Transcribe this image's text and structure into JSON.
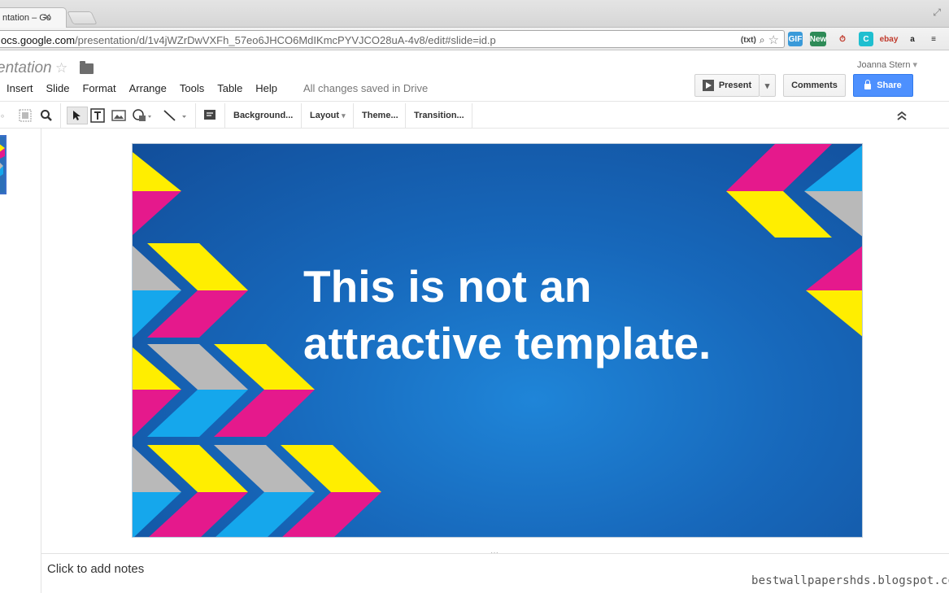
{
  "browser": {
    "tab_title": "ntation – Go",
    "tab_close": "✕",
    "url_host": "ocs.google.com",
    "url_path": "/presentation/d/1v4jWZrDwVXFh_57eo6JHCO6MdIKmcPYVJCO28uA-4v8/edit#slide=id.p",
    "txt_badge": "(txt)",
    "extensions": [
      {
        "name": "gif-extension",
        "label": "GIF",
        "color": "#3a9ad9"
      },
      {
        "name": "new-extension",
        "label": "New",
        "color": "#2e8b57"
      },
      {
        "name": "timer-extension",
        "label": "⏱",
        "color": "#e9e9e9"
      },
      {
        "name": "c-extension",
        "label": "C",
        "color": "#1fbfd0"
      },
      {
        "name": "ebay-extension",
        "label": "ebay",
        "color": "#e9e9e9"
      },
      {
        "name": "amazon-extension",
        "label": "a",
        "color": "#e9e9e9"
      },
      {
        "name": "menu-extension",
        "label": "≡",
        "color": "#e9e9e9"
      }
    ]
  },
  "doc": {
    "title": "entation",
    "user": "Joanna Stern",
    "user_caret": "▾",
    "menu": [
      "Insert",
      "Slide",
      "Format",
      "Arrange",
      "Tools",
      "Table",
      "Help"
    ],
    "saved_status": "All changes saved in Drive",
    "present_label": "Present",
    "present_caret": "▾",
    "comments_label": "Comments",
    "share_label": "Share"
  },
  "toolbar": {
    "background_label": "Background...",
    "layout_label": "Layout",
    "layout_caret": "▾",
    "theme_label": "Theme...",
    "transition_label": "Transition...",
    "collapse_icon": "⌃"
  },
  "slide": {
    "title_line1": "This is not an",
    "title_line2": "attractive template.",
    "colors": {
      "background": "#1768bb",
      "yellow": "#ffee00",
      "magenta": "#e5198c",
      "gray": "#b9b9b9",
      "cyan": "#15a7ec"
    }
  },
  "notes": {
    "placeholder": "Click to add notes",
    "handle": "···"
  },
  "watermark": "bestwallpapershds.blogspot.com"
}
